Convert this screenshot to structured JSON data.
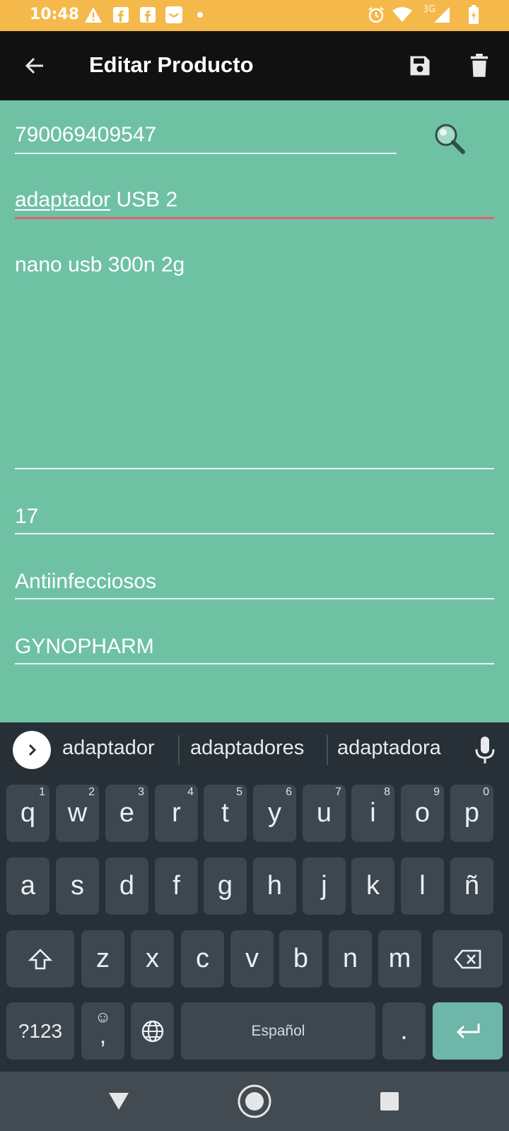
{
  "status_bar": {
    "time": "10:48",
    "network_label": "3G",
    "icons": [
      "warning-icon",
      "facebook-icon",
      "facebook-icon",
      "smile-icon",
      "dot-icon",
      "alarm-icon",
      "wifi-icon",
      "signal-icon",
      "battery-icon"
    ]
  },
  "app_bar": {
    "title": "Editar Producto",
    "icons": [
      "back-arrow-icon",
      "save-icon",
      "delete-icon"
    ]
  },
  "form": {
    "barcode": "790069409547",
    "name_first_word": "adaptador",
    "name_rest": " USB 2",
    "description": "nano usb 300n 2g",
    "quantity": "17",
    "category": "Antiinfecciosos",
    "brand": "GYNOPHARM"
  },
  "colors": {
    "form_background": "#6fc1a4",
    "error_underline": "#e5606f",
    "status_bar": "#f4b94a",
    "app_bar": "#111111",
    "keyboard_background": "#263036",
    "enter_key": "#6db6a8"
  },
  "keyboard": {
    "suggestions": [
      "adaptador",
      "adaptadores",
      "adaptadora"
    ],
    "row1": [
      {
        "label": "q",
        "hint": "1"
      },
      {
        "label": "w",
        "hint": "2"
      },
      {
        "label": "e",
        "hint": "3"
      },
      {
        "label": "r",
        "hint": "4"
      },
      {
        "label": "t",
        "hint": "5"
      },
      {
        "label": "y",
        "hint": "6"
      },
      {
        "label": "u",
        "hint": "7"
      },
      {
        "label": "i",
        "hint": "8"
      },
      {
        "label": "o",
        "hint": "9"
      },
      {
        "label": "p",
        "hint": "0"
      }
    ],
    "row2": [
      "a",
      "s",
      "d",
      "f",
      "g",
      "h",
      "j",
      "k",
      "l",
      "ñ"
    ],
    "row3": [
      "z",
      "x",
      "c",
      "v",
      "b",
      "n",
      "m"
    ],
    "symbols_label": "?123",
    "comma_label": ",",
    "space_label": "Español",
    "period_label": "."
  }
}
